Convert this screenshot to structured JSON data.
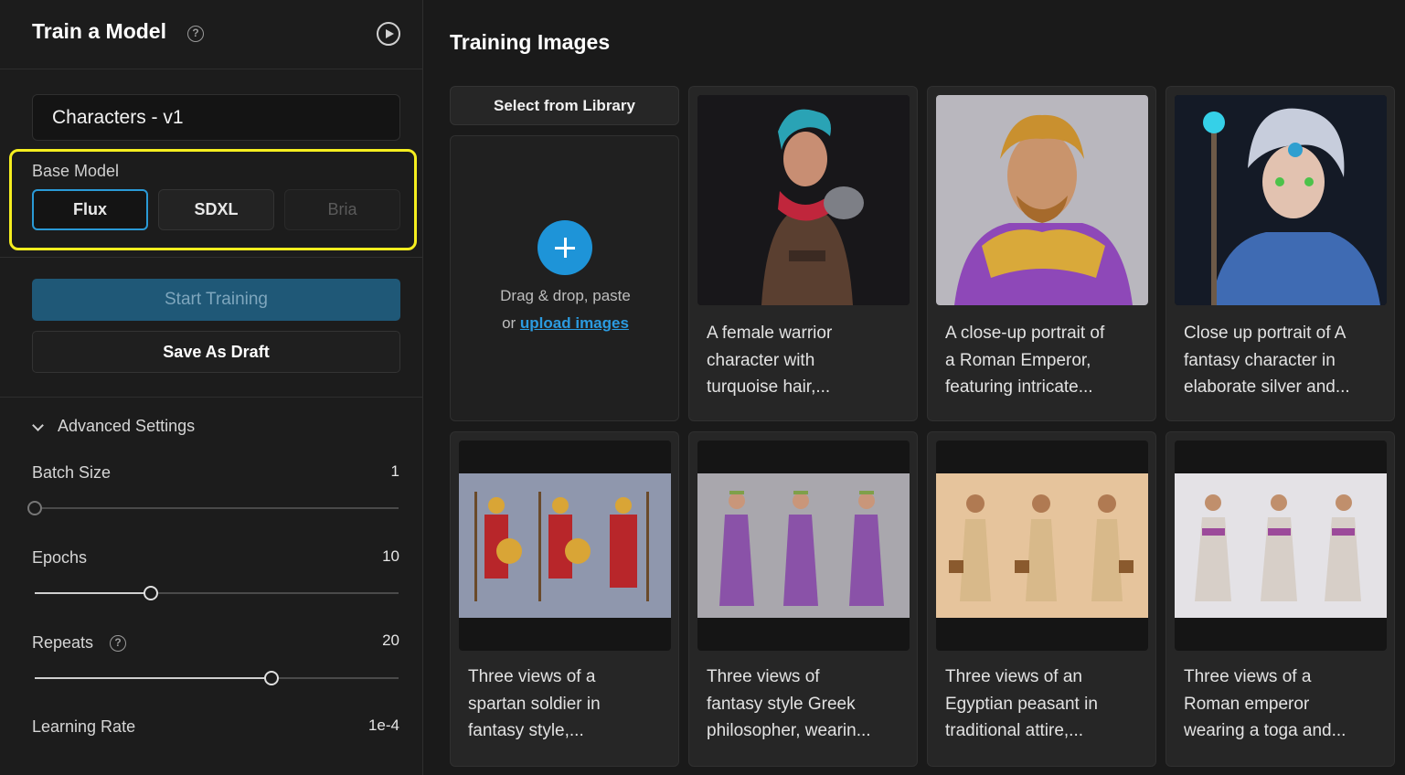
{
  "sidebar": {
    "title": "Train a Model",
    "model_name_value": "Characters - v1",
    "base_model": {
      "label": "Base Model",
      "options": [
        "Flux",
        "SDXL",
        "Bria"
      ],
      "selected": "Flux"
    },
    "start_training_label": "Start Training",
    "save_draft_label": "Save As Draft",
    "advanced_settings": {
      "label": "Advanced Settings",
      "expanded": true,
      "batch_size": {
        "label": "Batch Size",
        "value": "1",
        "fraction": 0.0
      },
      "epochs": {
        "label": "Epochs",
        "value": "10",
        "fraction": 0.32
      },
      "repeats": {
        "label": "Repeats",
        "value": "20",
        "fraction": 0.65
      },
      "learning_rate": {
        "label": "Learning Rate",
        "value": "1e-4"
      }
    }
  },
  "main": {
    "title": "Training Images",
    "select_library_label": "Select from Library",
    "dropzone": {
      "line1": "Drag & drop, paste",
      "line2_prefix": "or ",
      "upload_link": "upload images"
    },
    "images": [
      {
        "caption_lines": [
          "A female warrior",
          "character with",
          "turquoise hair,..."
        ],
        "art": "female-warrior"
      },
      {
        "caption_lines": [
          "A close-up portrait of",
          "a Roman Emperor,",
          "featuring intricate..."
        ],
        "art": "roman-emperor-portrait"
      },
      {
        "caption_lines": [
          "Close up portrait of A",
          "fantasy character in",
          "elaborate silver and..."
        ],
        "art": "silver-fantasy-character"
      },
      {
        "caption_lines": [
          "Three views of a",
          "spartan soldier in",
          "fantasy style,..."
        ],
        "art": "spartan-soldier-views"
      },
      {
        "caption_lines": [
          "Three views of",
          "fantasy style Greek",
          "philosopher, wearin..."
        ],
        "art": "greek-philosopher-views"
      },
      {
        "caption_lines": [
          "Three views of an",
          "Egyptian peasant in",
          "traditional attire,..."
        ],
        "art": "egyptian-peasant-views"
      },
      {
        "caption_lines": [
          "Three views of a",
          "Roman emperor",
          "wearing a toga and..."
        ],
        "art": "roman-emperor-views"
      }
    ]
  },
  "colors": {
    "accent": "#1e94d8",
    "highlight_box": "#f5ee1f",
    "start_button": "#1f5877",
    "background": "#1a1a1a"
  }
}
